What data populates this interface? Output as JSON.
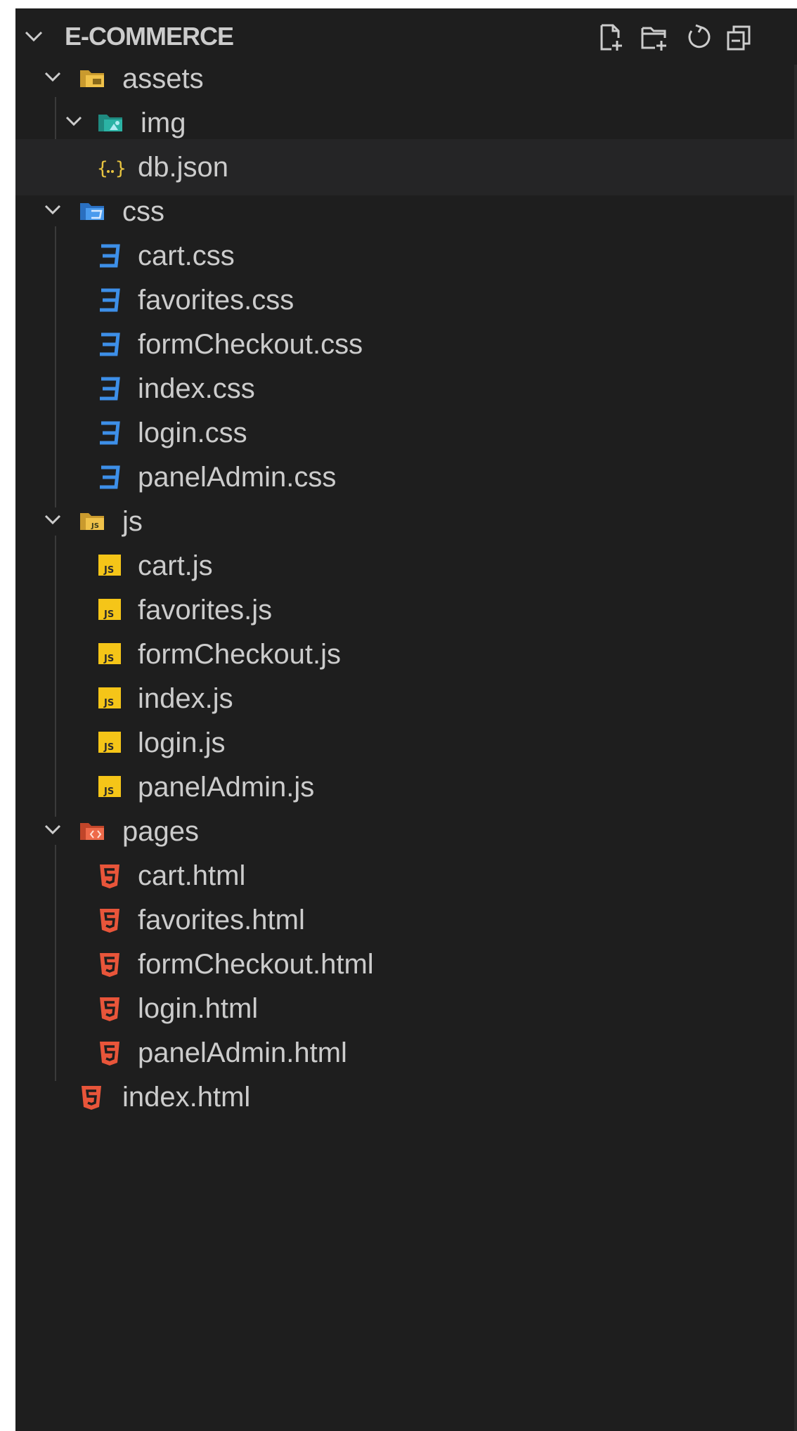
{
  "explorer": {
    "title": "E-COMMERCE",
    "toolbar": [
      {
        "name": "new-file-icon"
      },
      {
        "name": "new-folder-icon"
      },
      {
        "name": "refresh-icon"
      },
      {
        "name": "collapse-all-icon"
      }
    ],
    "items": [
      {
        "label": "assets",
        "kind": "folder",
        "icon": "folder-assets-icon",
        "color": "#e8b73a"
      },
      {
        "label": "img",
        "kind": "folder",
        "icon": "folder-images-icon",
        "color": "#26a69a"
      },
      {
        "label": "db.json",
        "kind": "file",
        "icon": "json-icon",
        "color": "#e8c440"
      },
      {
        "label": "css",
        "kind": "folder",
        "icon": "folder-css-icon",
        "color": "#3d8fe8"
      },
      {
        "label": "cart.css",
        "kind": "file",
        "icon": "css-icon",
        "color": "#3d8fe8"
      },
      {
        "label": "favorites.css",
        "kind": "file",
        "icon": "css-icon",
        "color": "#3d8fe8"
      },
      {
        "label": "formCheckout.css",
        "kind": "file",
        "icon": "css-icon",
        "color": "#3d8fe8"
      },
      {
        "label": "index.css",
        "kind": "file",
        "icon": "css-icon",
        "color": "#3d8fe8"
      },
      {
        "label": "login.css",
        "kind": "file",
        "icon": "css-icon",
        "color": "#3d8fe8"
      },
      {
        "label": "panelAdmin.css",
        "kind": "file",
        "icon": "css-icon",
        "color": "#3d8fe8"
      },
      {
        "label": "js",
        "kind": "folder",
        "icon": "folder-js-icon",
        "color": "#e8c440"
      },
      {
        "label": "cart.js",
        "kind": "file",
        "icon": "js-icon",
        "color": "#f5c518"
      },
      {
        "label": "favorites.js",
        "kind": "file",
        "icon": "js-icon",
        "color": "#f5c518"
      },
      {
        "label": "formCheckout.js",
        "kind": "file",
        "icon": "js-icon",
        "color": "#f5c518"
      },
      {
        "label": "index.js",
        "kind": "file",
        "icon": "js-icon",
        "color": "#f5c518"
      },
      {
        "label": "login.js",
        "kind": "file",
        "icon": "js-icon",
        "color": "#f5c518"
      },
      {
        "label": "panelAdmin.js",
        "kind": "file",
        "icon": "js-icon",
        "color": "#f5c518"
      },
      {
        "label": "pages",
        "kind": "folder",
        "icon": "folder-pages-icon",
        "color": "#e8553a"
      },
      {
        "label": "cart.html",
        "kind": "file",
        "icon": "html-icon",
        "color": "#e8553a"
      },
      {
        "label": "favorites.html",
        "kind": "file",
        "icon": "html-icon",
        "color": "#e8553a"
      },
      {
        "label": "formCheckout.html",
        "kind": "file",
        "icon": "html-icon",
        "color": "#e8553a"
      },
      {
        "label": "login.html",
        "kind": "file",
        "icon": "html-icon",
        "color": "#e8553a"
      },
      {
        "label": "panelAdmin.html",
        "kind": "file",
        "icon": "html-icon",
        "color": "#e8553a"
      },
      {
        "label": "index.html",
        "kind": "file",
        "icon": "html-icon",
        "color": "#e8553a"
      }
    ]
  }
}
